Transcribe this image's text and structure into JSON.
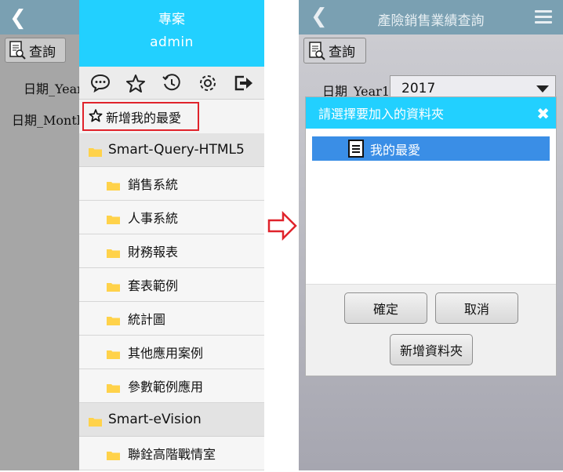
{
  "left": {
    "background": {
      "query_label": "查詢",
      "year_label": "日期_Year",
      "month_label": "日期_Month"
    },
    "drawer": {
      "title": "專案",
      "user": "admin",
      "icons": [
        "chat-icon",
        "star-icon",
        "history-icon",
        "gear-icon",
        "logout-icon"
      ],
      "add_favorite_label": "新增我的最愛",
      "groups": [
        {
          "label": "Smart-Query-HTML5",
          "items": [
            "銷售系統",
            "人事系統",
            "財務報表",
            "套表範例",
            "統計圖",
            "其他應用案例",
            "參數範例應用"
          ]
        },
        {
          "label": "Smart-eVision",
          "items": [
            "聯銓高階戰情室"
          ]
        }
      ]
    }
  },
  "right": {
    "header_title": "產險銷售業績查詢",
    "query_label": "查詢",
    "year_label": "日期_Year1",
    "year_value": "2017",
    "dialog": {
      "title": "請選擇要加入的資料夾",
      "folder_item": "我的最愛",
      "ok_label": "確定",
      "cancel_label": "取消",
      "new_folder_label": "新增資料夾"
    }
  },
  "colors": {
    "accent": "#22d0ff",
    "header_dim": "#7aa0b2",
    "highlight_border": "#e0232b",
    "selected_row": "#3a8ee6",
    "folder_yellow": "#ffd24a"
  }
}
